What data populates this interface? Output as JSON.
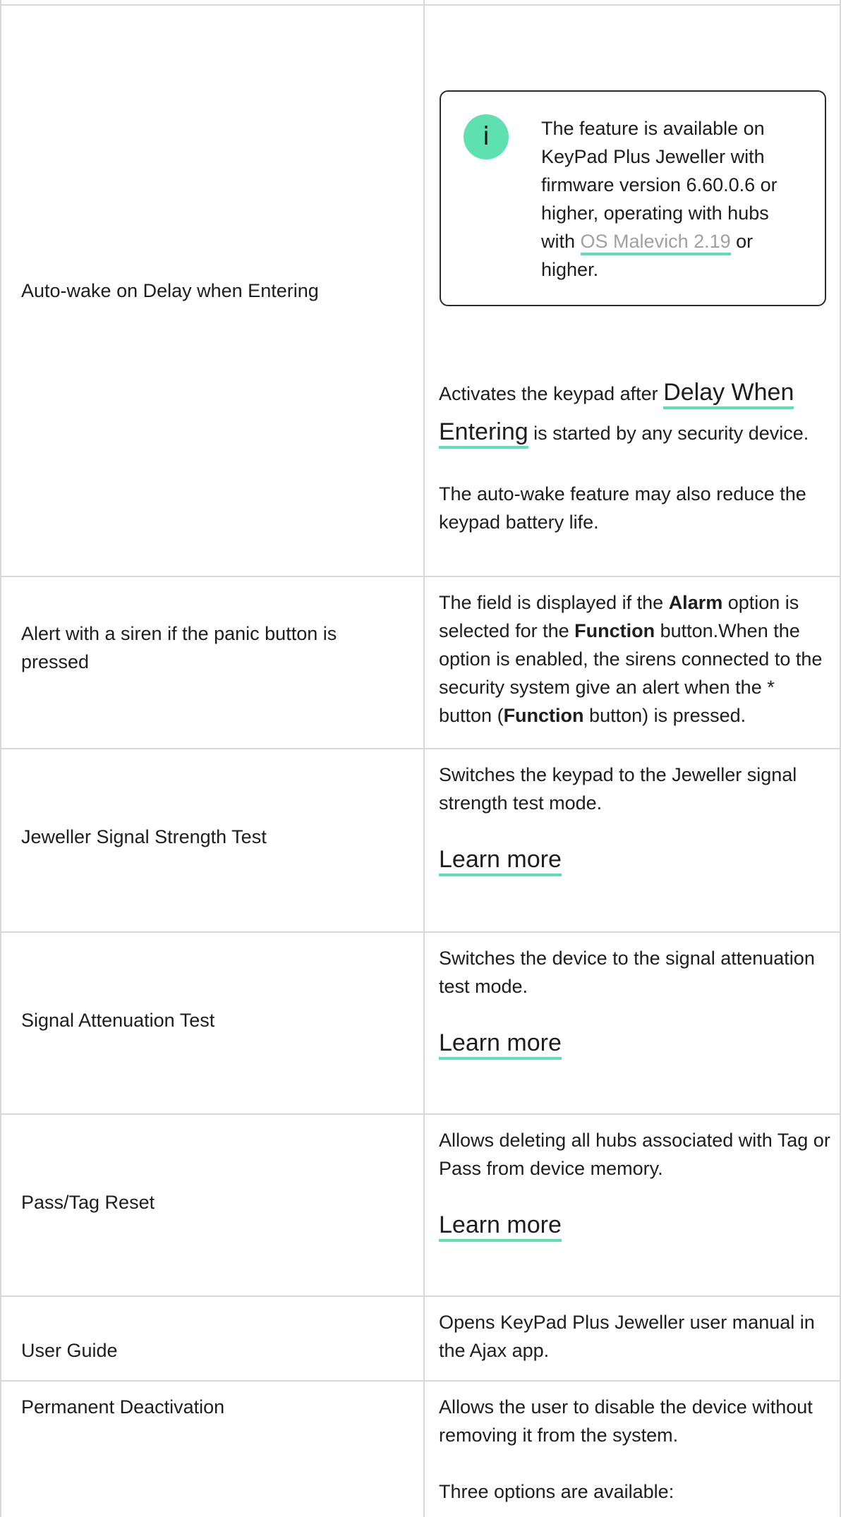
{
  "rows": [
    {
      "label": "Auto-wake on Delay when Entering",
      "notice": {
        "text_before": "The feature is available on KeyPad Plus Jeweller with firmware version 6.60.0.6 or higher, operating with hubs with ",
        "link": "OS Malevich 2.19",
        "text_after": " or higher."
      },
      "p1_before": "Activates the keypad after ",
      "p1_link": "Delay When Entering",
      "p1_after": " is started by any security device.",
      "p2": "The auto-wake feature may also reduce the keypad battery life."
    },
    {
      "label": "Alert with a siren if the panic button is pressed",
      "t1": "The field is displayed if the ",
      "b1": "Alarm",
      "t2": " option is selected for the ",
      "b2": "Function",
      "t3": " button.When the option is enabled, the sirens connected to the security system give an alert when the * button (",
      "b3": "Function",
      "t4": " button) is pressed."
    },
    {
      "label": "Jeweller Signal Strength Test",
      "desc": "Switches the keypad to the Jeweller signal strength test mode.",
      "link": "Learn more"
    },
    {
      "label": "Signal Attenuation Test",
      "desc": "Switches the device to the signal attenuation test mode.",
      "link": "Learn more"
    },
    {
      "label": "Pass/Tag Reset",
      "desc": "Allows deleting all hubs associated with Tag or Pass from device memory.",
      "link": "Learn more"
    },
    {
      "label": "User Guide",
      "desc": "Opens KeyPad Plus Jeweller user manual in the Ajax app."
    },
    {
      "label": "Permanent Deactivation",
      "desc": "Allows the user to disable the device without removing it from the system.",
      "desc2": "Three options are available:"
    }
  ],
  "colors": {
    "accent": "#5fe0b0",
    "border": "#d7d7d7",
    "text": "#1d1d1d",
    "muted_link": "#a0a0a0"
  },
  "icons": {
    "notice": "info-icon"
  }
}
